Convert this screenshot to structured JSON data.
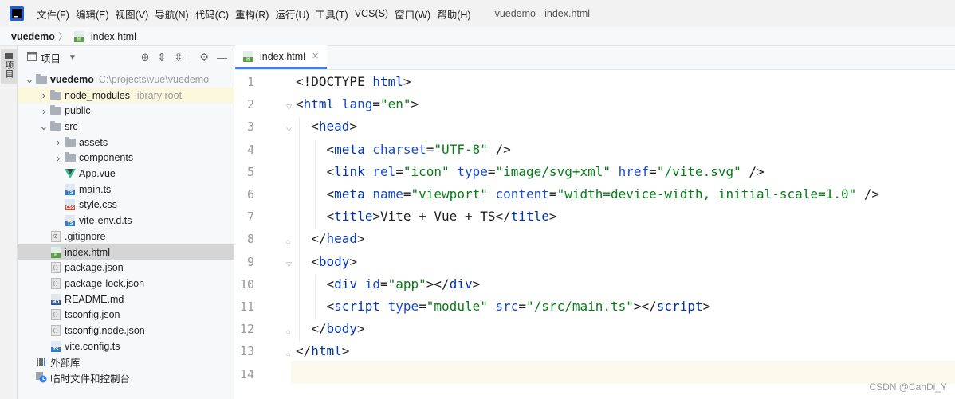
{
  "menubar": {
    "items": [
      "文件(F)",
      "编辑(E)",
      "视图(V)",
      "导航(N)",
      "代码(C)",
      "重构(R)",
      "运行(U)",
      "工具(T)",
      "VCS(S)",
      "窗口(W)",
      "帮助(H)"
    ],
    "window_title": "vuedemo - index.html",
    "logo_icon": "webstorm-logo-icon"
  },
  "breadcrumb": {
    "project": "vuedemo",
    "separator": "〉",
    "file": "index.html"
  },
  "toolstrip": {
    "project_tab": "项目"
  },
  "project_panel": {
    "title": "项目",
    "tree": [
      {
        "label": "vuedemo",
        "hint": "C:\\projects\\vue\\vuedemo",
        "type": "folder",
        "expanded": true,
        "bold": true
      },
      {
        "label": "node_modules",
        "hint": "library root",
        "type": "folder",
        "expanded": false
      },
      {
        "label": "public",
        "type": "folder",
        "expanded": false
      },
      {
        "label": "src",
        "type": "folder",
        "expanded": true
      },
      {
        "label": "assets",
        "type": "folder",
        "expanded": false
      },
      {
        "label": "components",
        "type": "folder",
        "expanded": false
      },
      {
        "label": "App.vue",
        "type": "vue"
      },
      {
        "label": "main.ts",
        "type": "ts"
      },
      {
        "label": "style.css",
        "type": "css"
      },
      {
        "label": "vite-env.d.ts",
        "type": "ts"
      },
      {
        "label": ".gitignore",
        "type": "git"
      },
      {
        "label": "index.html",
        "type": "html",
        "selected": true
      },
      {
        "label": "package.json",
        "type": "json"
      },
      {
        "label": "package-lock.json",
        "type": "json"
      },
      {
        "label": "README.md",
        "type": "md"
      },
      {
        "label": "tsconfig.json",
        "type": "json"
      },
      {
        "label": "tsconfig.node.json",
        "type": "json"
      },
      {
        "label": "vite.config.ts",
        "type": "ts"
      },
      {
        "label": "外部库",
        "type": "libs"
      },
      {
        "label": "临时文件和控制台",
        "type": "scratch"
      }
    ]
  },
  "editor": {
    "tab_label": "index.html",
    "line_numbers": [
      "1",
      "2",
      "3",
      "4",
      "5",
      "6",
      "7",
      "8",
      "9",
      "10",
      "11",
      "12",
      "13",
      "14"
    ],
    "current_line": "14",
    "code": [
      [
        [
          "tx",
          "<!DOCTYPE "
        ],
        [
          "tg",
          "html"
        ],
        [
          "tx",
          ">"
        ]
      ],
      [
        [
          "tx",
          "<"
        ],
        [
          "tg",
          "html "
        ],
        [
          "at",
          "lang"
        ],
        [
          "tx",
          "="
        ],
        [
          "st",
          "\"en\""
        ],
        [
          "tx",
          ">"
        ]
      ],
      [
        [
          "tx",
          "  <"
        ],
        [
          "tg",
          "head"
        ],
        [
          "tx",
          ">"
        ]
      ],
      [
        [
          "tx",
          "    <"
        ],
        [
          "tg",
          "meta "
        ],
        [
          "at",
          "charset"
        ],
        [
          "tx",
          "="
        ],
        [
          "st",
          "\"UTF-8\""
        ],
        [
          "tx",
          " />"
        ]
      ],
      [
        [
          "tx",
          "    <"
        ],
        [
          "tg",
          "link "
        ],
        [
          "at",
          "rel"
        ],
        [
          "tx",
          "="
        ],
        [
          "st",
          "\"icon\""
        ],
        [
          "tx",
          " "
        ],
        [
          "at",
          "type"
        ],
        [
          "tx",
          "="
        ],
        [
          "st",
          "\"image/svg+xml\""
        ],
        [
          "tx",
          " "
        ],
        [
          "at",
          "href"
        ],
        [
          "tx",
          "="
        ],
        [
          "st",
          "\"/vite.svg\""
        ],
        [
          "tx",
          " />"
        ]
      ],
      [
        [
          "tx",
          "    <"
        ],
        [
          "tg",
          "meta "
        ],
        [
          "at",
          "name"
        ],
        [
          "tx",
          "="
        ],
        [
          "st",
          "\"viewport\""
        ],
        [
          "tx",
          " "
        ],
        [
          "at",
          "content"
        ],
        [
          "tx",
          "="
        ],
        [
          "st",
          "\"width=device-width, initial-scale=1.0\""
        ],
        [
          "tx",
          " />"
        ]
      ],
      [
        [
          "tx",
          "    <"
        ],
        [
          "tg",
          "title"
        ],
        [
          "tx",
          ">Vite + Vue + TS</"
        ],
        [
          "tg",
          "title"
        ],
        [
          "tx",
          ">"
        ]
      ],
      [
        [
          "tx",
          "  </"
        ],
        [
          "tg",
          "head"
        ],
        [
          "tx",
          ">"
        ]
      ],
      [
        [
          "tx",
          "  <"
        ],
        [
          "tg",
          "body"
        ],
        [
          "tx",
          ">"
        ]
      ],
      [
        [
          "tx",
          "    <"
        ],
        [
          "tg",
          "div "
        ],
        [
          "at",
          "id"
        ],
        [
          "tx",
          "="
        ],
        [
          "st",
          "\"app\""
        ],
        [
          "tx",
          "></"
        ],
        [
          "tg",
          "div"
        ],
        [
          "tx",
          ">"
        ]
      ],
      [
        [
          "tx",
          "    <"
        ],
        [
          "tg",
          "script "
        ],
        [
          "at",
          "type"
        ],
        [
          "tx",
          "="
        ],
        [
          "st",
          "\"module\""
        ],
        [
          "tx",
          " "
        ],
        [
          "at",
          "src"
        ],
        [
          "tx",
          "="
        ],
        [
          "st",
          "\"/src/main.ts\""
        ],
        [
          "tx",
          "></"
        ],
        [
          "tg",
          "script"
        ],
        [
          "tx",
          ">"
        ]
      ],
      [
        [
          "tx",
          "  </"
        ],
        [
          "tg",
          "body"
        ],
        [
          "tx",
          ">"
        ]
      ],
      [
        [
          "tx",
          "</"
        ],
        [
          "tg",
          "html"
        ],
        [
          "tx",
          ">"
        ]
      ],
      []
    ]
  },
  "watermark": "CSDN @CanDi_Y"
}
